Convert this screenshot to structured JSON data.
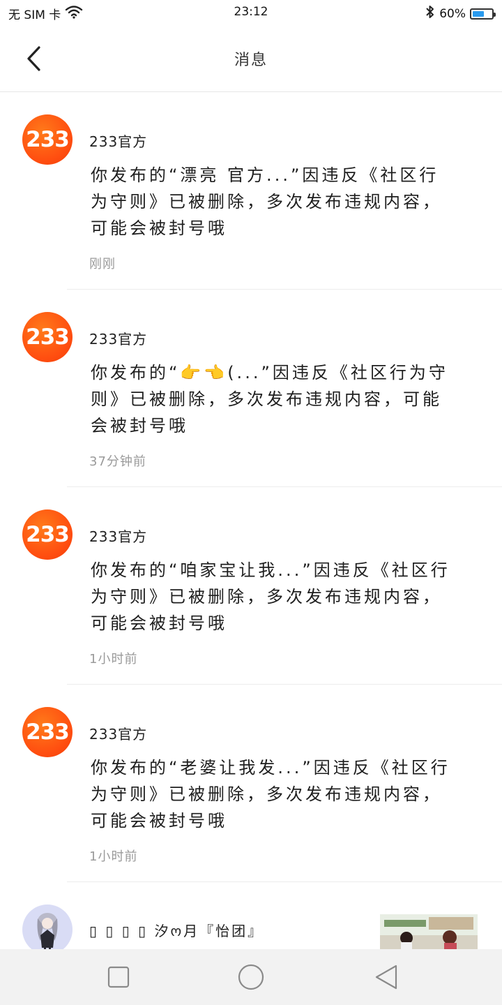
{
  "status_bar": {
    "carrier": "无 SIM 卡",
    "time": "23:12",
    "battery_percent": "60%",
    "battery_level": 0.6
  },
  "header": {
    "title": "消息"
  },
  "messages": [
    {
      "sender": "233官方",
      "avatar_text": "233",
      "text": "你发布的“漂亮 官方...”因违反《社区行为守则》已被删除，多次发布违规内容，可能会被封号哦",
      "time": "刚刚"
    },
    {
      "sender": "233官方",
      "avatar_text": "233",
      "text": "你发布的“👉👈(...”因违反《社区行为守则》已被删除，多次发布违规内容，可能会被封号哦",
      "time": "37分钟前"
    },
    {
      "sender": "233官方",
      "avatar_text": "233",
      "text": "你发布的“咱家宝让我...”因违反《社区行为守则》已被删除，多次发布违规内容，可能会被封号哦",
      "time": "1小时前"
    },
    {
      "sender": "233官方",
      "avatar_text": "233",
      "text": "你发布的“老婆让我发...”因违反《社区行为守则》已被删除，多次发布违规内容，可能会被封号哦",
      "time": "1小时前"
    }
  ],
  "partial_message": {
    "sender": "▯ ▯ ▯ ▯ 汐ო月『怡团』"
  },
  "colors": {
    "brand_orange": "#ff5412",
    "divider": "#ececec",
    "time_gray": "#9a9a9a"
  }
}
